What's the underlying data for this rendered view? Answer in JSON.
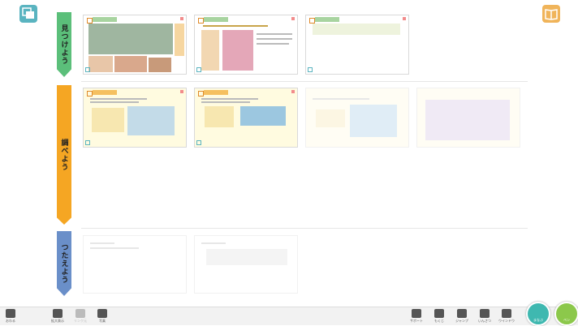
{
  "steps": [
    {
      "label": "見つけよう",
      "color": "#5bbf7a"
    },
    {
      "label": "調べよう",
      "color": "#f5a623"
    },
    {
      "label": "つたえよう",
      "color": "#6a8fc9"
    }
  ],
  "toolbar": {
    "left": [
      {
        "icon": "power-icon",
        "label": "おわる"
      },
      {
        "icon": "zoom-in-icon",
        "label": "拡大表示"
      },
      {
        "icon": "redo-icon",
        "label": "リンク元"
      },
      {
        "icon": "image-icon",
        "label": "写真"
      }
    ],
    "right": [
      {
        "icon": "gear-icon",
        "label": "サポート"
      },
      {
        "icon": "grid-icon",
        "label": "もくじ"
      },
      {
        "icon": "book-icon",
        "label": "ジャンプ"
      },
      {
        "icon": "printer-icon",
        "label": "いんさつ"
      },
      {
        "icon": "window-icon",
        "label": "ウインドウ"
      }
    ],
    "mark_label": "まなぶ",
    "pen_label": "ペン"
  },
  "colors": {
    "teal": "#5ab4c0",
    "orange": "#f0b45a",
    "green": "#5bbf7a",
    "amber": "#f5a623",
    "blue": "#6a8fc9"
  }
}
